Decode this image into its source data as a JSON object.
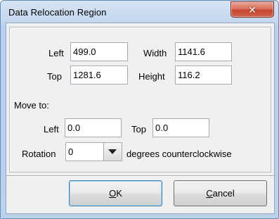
{
  "window": {
    "title": "Data Relocation Region",
    "close_symbol": "✕"
  },
  "region": {
    "left_label": "Left",
    "left_value": "499.0",
    "width_label": "Width",
    "width_value": "1141.6",
    "top_label": "Top",
    "top_value": "1281.6",
    "height_label": "Height",
    "height_value": "116.2"
  },
  "move_to": {
    "heading": "Move to:",
    "left_label": "Left",
    "left_value": "0.0",
    "top_label": "Top",
    "top_value": "0.0"
  },
  "rotation": {
    "label": "Rotation",
    "value": "0",
    "suffix": "degrees counterclockwise"
  },
  "buttons": {
    "ok_mnemonic": "O",
    "ok_rest": "K",
    "cancel_mnemonic": "C",
    "cancel_rest": "ancel"
  }
}
